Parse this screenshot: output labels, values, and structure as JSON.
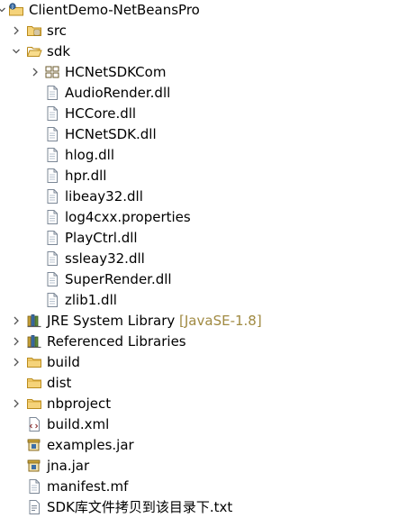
{
  "tree": {
    "project": {
      "label": "ClientDemo-NetBeansPro",
      "expanded": true,
      "icon": "java-project-icon"
    },
    "src": {
      "label": "src",
      "expanded": false,
      "icon": "source-folder-icon"
    },
    "sdk": {
      "label": "sdk",
      "expanded": true,
      "icon": "folder-open-icon",
      "children": [
        {
          "label": "HCNetSDKCom",
          "icon": "package-folder-icon",
          "expandable": true
        },
        {
          "label": "AudioRender.dll",
          "icon": "file-icon"
        },
        {
          "label": "HCCore.dll",
          "icon": "file-icon"
        },
        {
          "label": "HCNetSDK.dll",
          "icon": "file-icon"
        },
        {
          "label": "hlog.dll",
          "icon": "file-icon"
        },
        {
          "label": "hpr.dll",
          "icon": "file-icon"
        },
        {
          "label": "libeay32.dll",
          "icon": "file-icon"
        },
        {
          "label": "log4cxx.properties",
          "icon": "file-icon"
        },
        {
          "label": "PlayCtrl.dll",
          "icon": "file-icon"
        },
        {
          "label": "ssleay32.dll",
          "icon": "file-icon"
        },
        {
          "label": "SuperRender.dll",
          "icon": "file-icon"
        },
        {
          "label": "zlib1.dll",
          "icon": "file-icon"
        }
      ]
    },
    "jre": {
      "label": "JRE System Library",
      "decoration": "[JavaSE-1.8]",
      "icon": "library-icon"
    },
    "referenced": {
      "label": "Referenced Libraries",
      "icon": "library-icon"
    },
    "build": {
      "label": "build",
      "icon": "folder-icon",
      "expandable": true
    },
    "dist": {
      "label": "dist",
      "icon": "folder-icon",
      "expandable": false
    },
    "nbproject": {
      "label": "nbproject",
      "icon": "folder-icon",
      "expandable": true
    },
    "files": [
      {
        "label": "build.xml",
        "icon": "xml-file-icon"
      },
      {
        "label": "examples.jar",
        "icon": "jar-file-icon"
      },
      {
        "label": "jna.jar",
        "icon": "jar-file-icon"
      },
      {
        "label": "manifest.mf",
        "icon": "file-icon"
      },
      {
        "label": "SDK库文件拷贝到该目录下.txt",
        "icon": "text-file-icon"
      }
    ]
  },
  "colors": {
    "folder": "#e6b84a",
    "decoration": "#a08a42",
    "twisty": "#555555",
    "library": "#3d6fa8"
  }
}
